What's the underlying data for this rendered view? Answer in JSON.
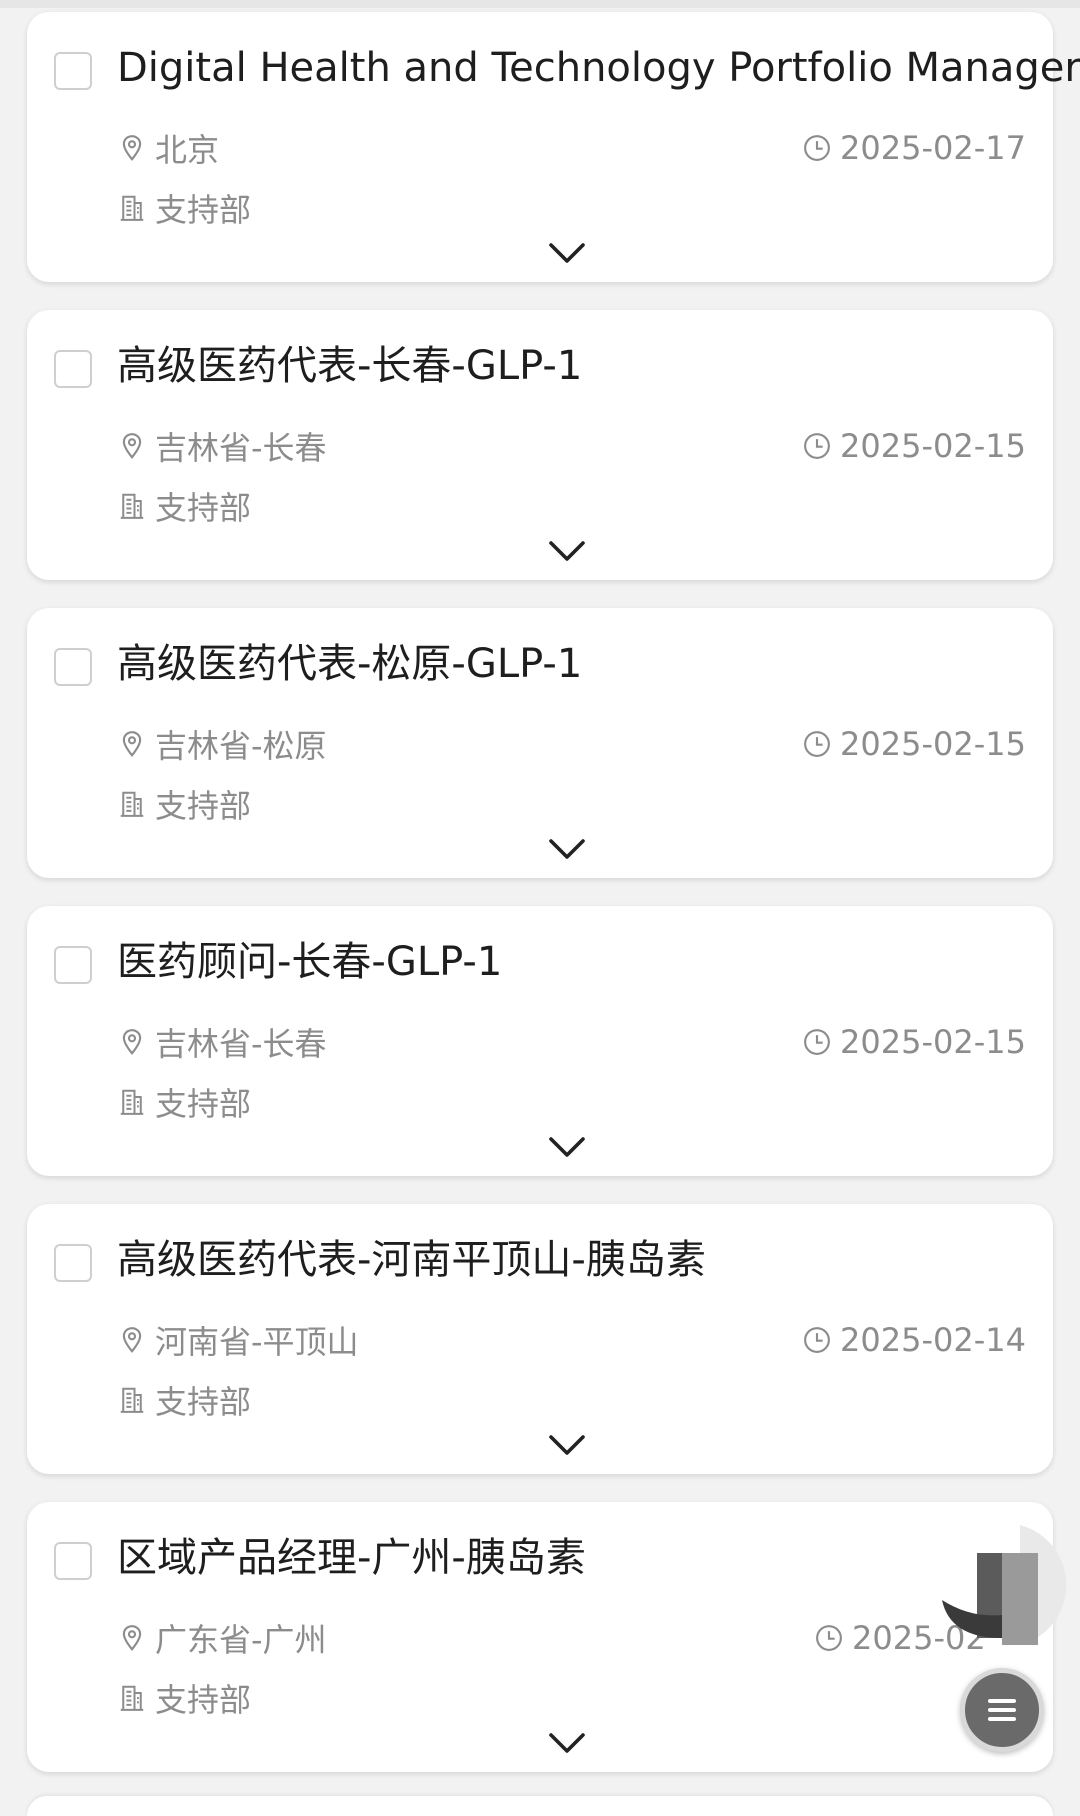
{
  "jobs": [
    {
      "title": "Digital Health and Technology Portfolio Manager",
      "location": "北京",
      "date": "2025-02-17",
      "department": "支持部"
    },
    {
      "title": "高级医药代表-长春-GLP-1",
      "location": "吉林省-长春",
      "date": "2025-02-15",
      "department": "支持部"
    },
    {
      "title": "高级医药代表-松原-GLP-1",
      "location": "吉林省-松原",
      "date": "2025-02-15",
      "department": "支持部"
    },
    {
      "title": "医药顾问-长春-GLP-1",
      "location": "吉林省-长春",
      "date": "2025-02-15",
      "department": "支持部"
    },
    {
      "title": "高级医药代表-河南平顶山-胰岛素",
      "location": "河南省-平顶山",
      "date": "2025-02-14",
      "department": "支持部"
    },
    {
      "title": "区域产品经理-广州-胰岛素",
      "location": "广东省-广州",
      "date": "2025-02",
      "department": "支持部"
    }
  ],
  "icons": {
    "location": "location-pin-icon",
    "date": "clock-icon",
    "department": "building-icon",
    "expand": "chevron-down-icon",
    "fab": "menu-icon"
  }
}
